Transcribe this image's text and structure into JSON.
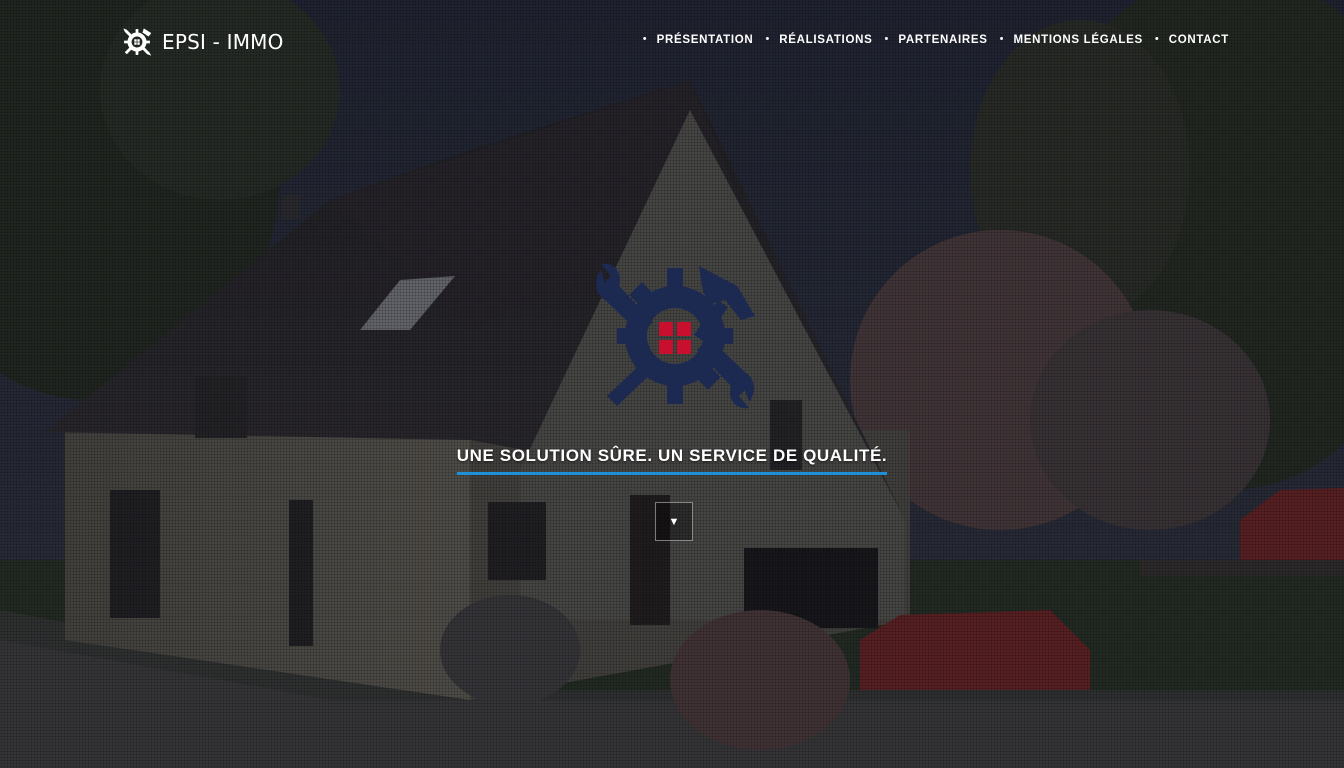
{
  "brand": {
    "name": "EPSI - IMMO",
    "icon": "gear-wrench-hammer-logo-icon"
  },
  "nav": {
    "separator": "•",
    "items": [
      {
        "label": "PRÉSENTATION"
      },
      {
        "label": "RÉALISATIONS"
      },
      {
        "label": "PARTENAIRES"
      },
      {
        "label": "MENTIONS LÉGALES"
      },
      {
        "label": "CONTACT"
      }
    ]
  },
  "hero": {
    "logo_icon": "gear-wrench-hammer-logo-icon",
    "tagline": "UNE SOLUTION SÛRE. UN SERVICE DE QUALITÉ.",
    "scroll_button": {
      "label": "▼",
      "icon": "triangle-down-icon"
    }
  },
  "colors": {
    "accent_underline": "#1e90d8",
    "logo_navy": "#1c2a52",
    "logo_red": "#c8102e",
    "text": "#ffffff"
  }
}
